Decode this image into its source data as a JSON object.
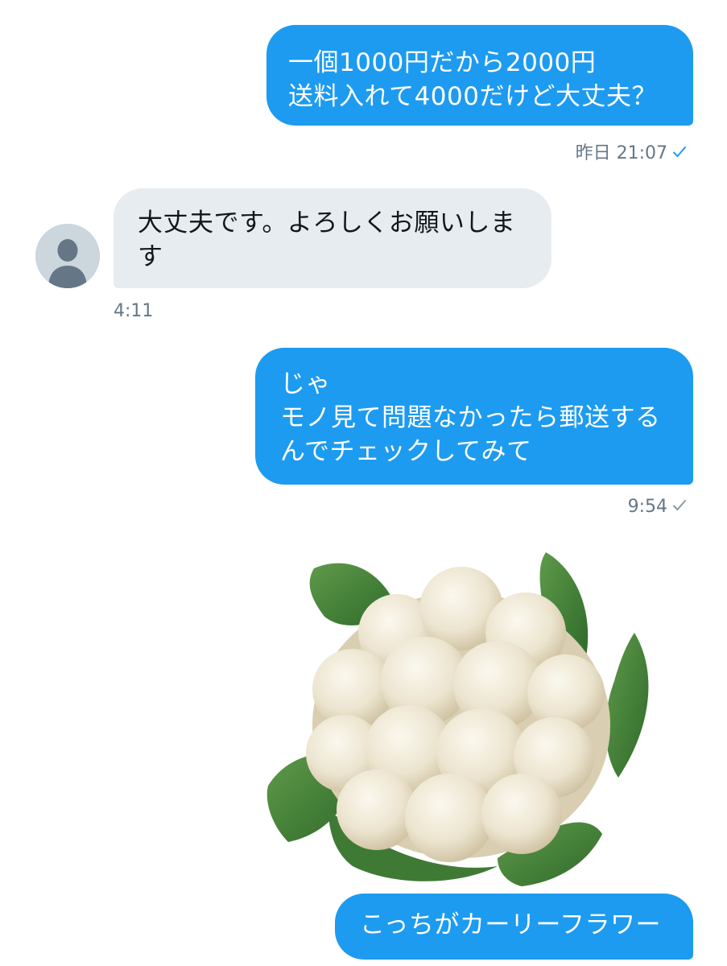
{
  "conversation": {
    "messages": [
      {
        "direction": "outgoing",
        "text": "一個1000円だから2000円\n送料入れて4000だけど大丈夫？",
        "meta": "昨日 21:07"
      },
      {
        "direction": "incoming",
        "text": "大丈夫です。よろしくお願いしま\nす",
        "meta": "4:11"
      },
      {
        "direction": "outgoing",
        "text": "じゃ\nモノ見て問題なかったら郵送する\nんでチェックしてみて",
        "meta": "9:54"
      },
      {
        "direction": "outgoing",
        "type": "image",
        "image": "cauliflower-photo"
      },
      {
        "direction": "outgoing",
        "text": "こっちがカーリーフラワー"
      }
    ]
  },
  "colors": {
    "outgoing_bubble": "#1d9bf0",
    "incoming_bubble": "#e6ecf0",
    "meta_text": "#657786",
    "read_check_blue": "#1d9bf0",
    "read_check_gray": "#8899a6"
  },
  "icons": {
    "read_receipt": "checkmark-icon",
    "avatar": "default-avatar-icon"
  }
}
